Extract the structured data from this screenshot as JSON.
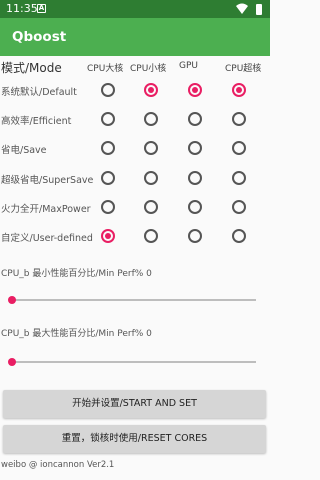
{
  "status": {
    "time": "11:35",
    "notification": "A"
  },
  "app": {
    "title": "Qboost",
    "accent": "#e91e63",
    "appbar_color": "#4caf50",
    "statusbar_color": "#2e7d32"
  },
  "table": {
    "mode_header": "模式/Mode",
    "columns": [
      "CPU大核",
      "CPU小核",
      "GPU",
      "CPU超核"
    ],
    "rows": [
      {
        "label": "系统默认/Default",
        "checked": [
          false,
          true,
          true,
          true
        ]
      },
      {
        "label": "高效率/Efficient",
        "checked": [
          false,
          false,
          false,
          false
        ]
      },
      {
        "label": "省电/Save",
        "checked": [
          false,
          false,
          false,
          false
        ]
      },
      {
        "label": "超级省电/SuperSave",
        "checked": [
          false,
          false,
          false,
          false
        ]
      },
      {
        "label": "火力全开/MaxPower",
        "checked": [
          false,
          false,
          false,
          false
        ]
      },
      {
        "label": "自定义/User-defined",
        "checked": [
          true,
          false,
          false,
          false
        ]
      }
    ]
  },
  "sliders": [
    {
      "label": "CPU_b 最小性能百分比/Min Perf% 0",
      "value_percent": 0
    },
    {
      "label": "CPU_b 最大性能百分比/Min Perf% 0",
      "value_percent": 0
    }
  ],
  "buttons": {
    "start": "开始并设置/START AND SET",
    "reset": "重置，锁核时使用/RESET CORES"
  },
  "footer": "weibo @ ioncannon Ver2.1"
}
